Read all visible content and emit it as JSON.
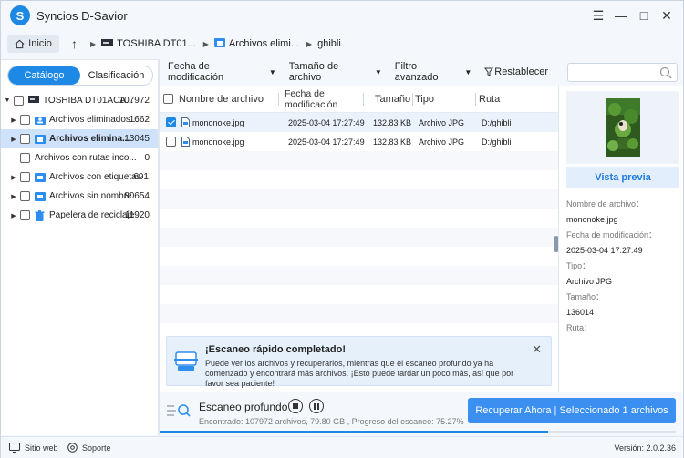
{
  "app": {
    "title": "Syncios D-Savior",
    "logo_letter": "S"
  },
  "window_controls": {
    "menu": "☰",
    "minimize": "—",
    "maximize": "□",
    "close": "✕"
  },
  "nav": {
    "home_label": "Inicio",
    "up_icon": "↑",
    "breadcrumbs": [
      "TOSHIBA DT01...",
      "Archivos elimi...",
      "ghibli"
    ]
  },
  "left": {
    "tabs": [
      "Catálogo",
      "Clasificación"
    ],
    "drive": {
      "label": "TOSHIBA DT01ACA...",
      "count": "107972"
    },
    "items": [
      {
        "label": "Archivos eliminados...",
        "count": "1662",
        "icon": "user-folder-icon"
      },
      {
        "label": "Archivos elimina...",
        "count": "13045",
        "icon": "deleted-folder-icon"
      },
      {
        "label": "Archivos con rutas inco...",
        "count": "0",
        "icon": "none"
      },
      {
        "label": "Archivos con etiquetas",
        "count": "691",
        "icon": "tag-folder-icon"
      },
      {
        "label": "Archivos sin nombre",
        "count": "80654",
        "icon": "unnamed-folder-icon"
      },
      {
        "label": "Papelera de reciclaje",
        "count": "11920",
        "icon": "recycle-bin-icon"
      }
    ]
  },
  "toolbar": {
    "filter_date": "Fecha de modificación",
    "filter_size": "Tamaño de archivo",
    "filter_advanced": "Filtro avanzado",
    "reset": "Restablecer"
  },
  "table": {
    "headers": {
      "name": "Nombre de archivo",
      "date": "Fecha de modificación",
      "size": "Tamaño",
      "type": "Tipo",
      "path": "Ruta"
    },
    "rows": [
      {
        "name": "mononoke.jpg",
        "date": "2025-03-04 17:27:49",
        "size": "132.83 KB",
        "type": "Archivo JPG",
        "path": "D:/ghibli",
        "checked": true
      },
      {
        "name": "mononoke.jpg",
        "date": "2025-03-04 17:27:49",
        "size": "132.83 KB",
        "type": "Archivo JPG",
        "path": "D:/ghibli",
        "checked": false
      }
    ]
  },
  "preview": {
    "button": "Vista previa",
    "name_key": "Nombre de archivo：",
    "name_val": "mononoke.jpg",
    "date_key": "Fecha de modificación：",
    "date_val": "2025-03-04 17:27:49",
    "type_key": "Tipo：",
    "type_val": "Archivo JPG",
    "size_key": "Tamaño：",
    "size_val": "136014",
    "path_key": "Ruta："
  },
  "banner": {
    "title": "¡Escaneo rápido completado!",
    "text": "Puede ver los archivos y recuperarlos, mientras que el escaneo profundo ya ha comenzado y encontrará más archivos. ¡Esto puede tardar un poco más, así que por favor sea paciente!",
    "close": "✕"
  },
  "scan": {
    "label": "Escaneo profundo",
    "info": "Encontrado: 107972 archivos, 79.80 GB , Progreso del escaneo: 75.27%",
    "progress": 0.7527
  },
  "recover_button": "Recuperar Ahora | Seleccionado 1 archivos",
  "footer": {
    "website": "Sitio web",
    "support": "Soporte",
    "version": "Versión: 2.0.2.36"
  },
  "colors": {
    "accent": "#1e88e5",
    "button": "#3a8ff0",
    "selected_row": "#cfe2fb"
  }
}
